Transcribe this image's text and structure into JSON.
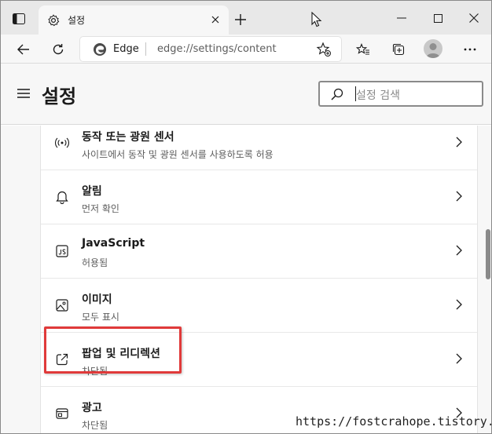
{
  "browser": {
    "tab": {
      "title": "설정"
    },
    "address_bar": {
      "site_label": "Edge",
      "url": "edge://settings/content"
    }
  },
  "settings": {
    "title": "설정",
    "search": {
      "placeholder": "설정 검색"
    },
    "items": [
      {
        "title": "동작 또는 광원 센서",
        "subtitle": "사이트에서 동작 및 광원 센서를 사용하도록 허용",
        "icon": "motion-sensor-icon"
      },
      {
        "title": "알림",
        "subtitle": "먼저 확인",
        "icon": "bell-icon"
      },
      {
        "title": "JavaScript",
        "subtitle": "허용됨",
        "icon": "javascript-icon"
      },
      {
        "title": "이미지",
        "subtitle": "모두 표시",
        "icon": "image-icon"
      },
      {
        "title": "팝업 및 리디렉션",
        "subtitle": "차단됨",
        "icon": "popup-external-icon"
      },
      {
        "title": "광고",
        "subtitle": "차단됨",
        "icon": "ads-icon"
      }
    ]
  },
  "watermark": "https://fostcrahope.tistory.com",
  "colors": {
    "highlight": "#e03a3a",
    "chrome_bg": "#e8e8e8",
    "panel_bg": "#f7f7f7"
  }
}
